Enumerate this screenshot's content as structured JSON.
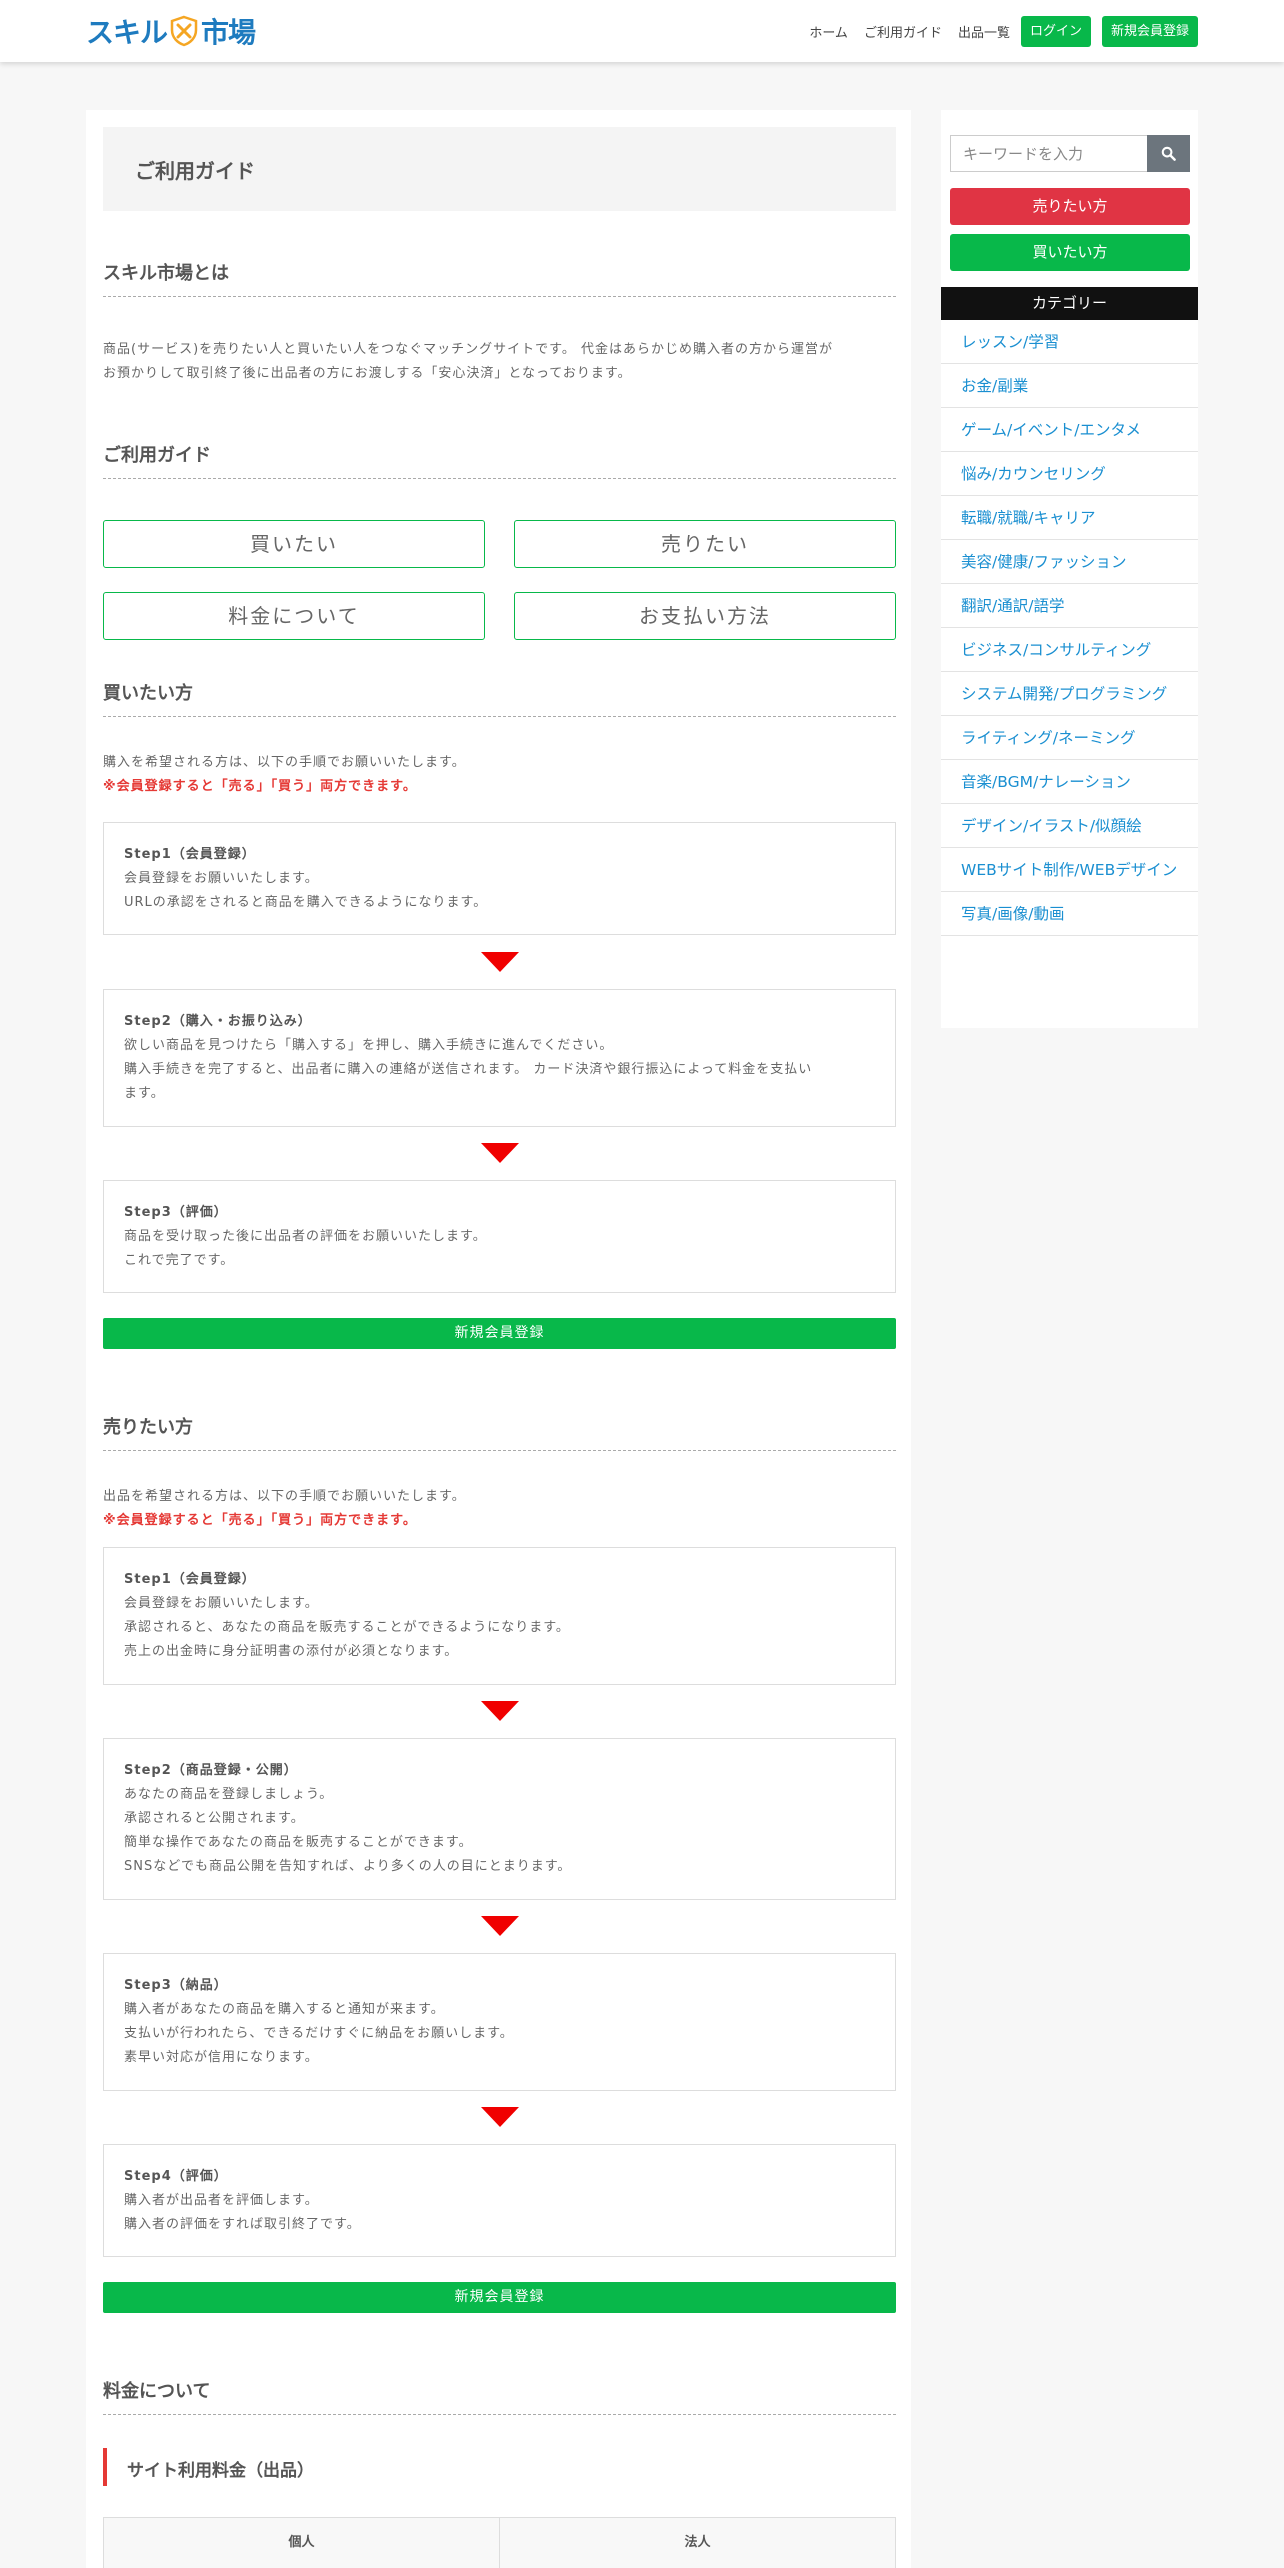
{
  "header": {
    "logo_left": "スキル",
    "logo_right": "市場",
    "nav": [
      "ホーム",
      "ご利用ガイド",
      "出品一覧"
    ],
    "login": "ログイン",
    "register": "新規会員登録"
  },
  "page_title": "ご利用ガイド",
  "about": {
    "heading": "スキル市場とは",
    "line1": "商品(サービス)を売りたい人と買いたい人をつなぐマッチングサイトです。 代金はあらかじめ購入者の方から運営が",
    "line2": "お預かりして取引終了後に出品者の方にお渡しする「安心決済」となっております。"
  },
  "guide": {
    "heading": "ご利用ガイド",
    "buttons": [
      "買いたい",
      "売りたい",
      "料金について",
      "お支払い方法"
    ]
  },
  "buyer": {
    "heading": "買いたい方",
    "intro": "購入を希望される方は、以下の手順でお願いいたします。",
    "note": "※会員登録すると「売る」「買う」両方できます。",
    "steps": [
      {
        "title": "Step1（会員登録）",
        "l1": "会員登録をお願いいたします。",
        "l2": "URLの承認をされると商品を購入できるようになります。"
      },
      {
        "title": "Step2（購入・お振り込み）",
        "l1": "欲しい商品を見つけたら「購入する」を押し、購入手続きに進んでください。",
        "l2": "購入手続きを完了すると、出品者に購入の連絡が送信されます。 カード決済や銀行振込によって料金を支払い",
        "l3": "ます。"
      },
      {
        "title": "Step3（評価）",
        "l1": "商品を受け取った後に出品者の評価をお願いいたします。",
        "l2": "これで完了です。"
      }
    ],
    "register": "新規会員登録"
  },
  "seller": {
    "heading": "売りたい方",
    "intro": "出品を希望される方は、以下の手順でお願いいたします。",
    "note": "※会員登録すると「売る」「買う」両方できます。",
    "steps": [
      {
        "title": "Step1（会員登録）",
        "l1": "会員登録をお願いいたします。",
        "l2": "承認されると、あなたの商品を販売することができるようになります。",
        "l3": "売上の出金時に身分証明書の添付が必須となります。"
      },
      {
        "title": "Step2（商品登録・公開）",
        "l1": "あなたの商品を登録しましょう。",
        "l2": "承認されると公開されます。",
        "l3": "簡単な操作であなたの商品を販売することができます。",
        "l4": "SNSなどでも商品公開を告知すれば、より多くの人の目にとまります。"
      },
      {
        "title": "Step3（納品）",
        "l1": "購入者があなたの商品を購入すると通知が来ます。",
        "l2": "支払いが行われたら、できるだけすぐに納品をお願いします。",
        "l3": "素早い対応が信用になります。"
      },
      {
        "title": "Step4（評価）",
        "l1": "購入者が出品者を評価します。",
        "l2": "購入者の評価をすれば取引終了です。"
      }
    ],
    "register": "新規会員登録"
  },
  "fees": {
    "heading": "料金について",
    "subheading": "サイト利用料金（出品）",
    "table_headers": [
      "個人",
      "法人"
    ]
  },
  "sidebar": {
    "search_placeholder": "キーワードを入力",
    "sell_btn": "売りたい方",
    "buy_btn": "買いたい方",
    "category_header": "カテゴリー",
    "categories": [
      "レッスン/学習",
      "お金/副業",
      "ゲーム/イベント/エンタメ",
      "悩み/カウンセリング",
      "転職/就職/キャリア",
      "美容/健康/ファッション",
      "翻訳/通訳/語学",
      "ビジネス/コンサルティング",
      "システム開発/プログラミング",
      "ライティング/ネーミング",
      "音楽/BGM/ナレーション",
      "デザイン/イラスト/似顔絵",
      "WEBサイト制作/WEBデザイン",
      "写真/画像/動画"
    ]
  },
  "colors": {
    "brand": "#1e7bbf",
    "accent_green": "#08b84a",
    "sell_red": "#e03444",
    "arrow_red": "#f00000"
  }
}
